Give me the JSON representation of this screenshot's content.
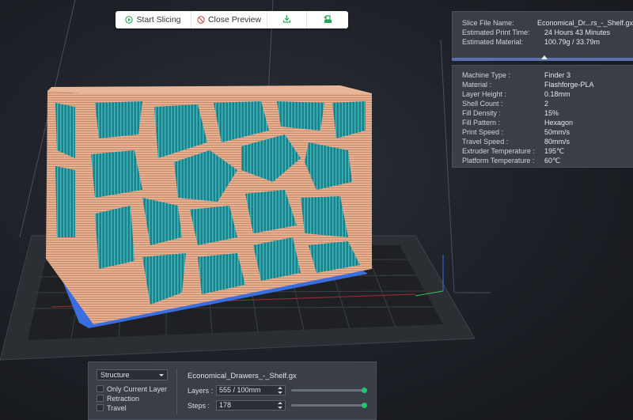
{
  "toolbar": {
    "start_label": "Start Slicing",
    "close_label": "Close Preview",
    "export_icon": "download-icon",
    "print_icon": "print-send-icon"
  },
  "info": {
    "rows": [
      {
        "k": "Slice File Name:",
        "v": "Economical_Dr...rs_-_Shelf.gx"
      },
      {
        "k": "Estimated Print Time:",
        "v": "24 Hours 43 Minutes"
      },
      {
        "k": "Estimated Material:",
        "v": "100.79g / 33.79m"
      }
    ]
  },
  "details": {
    "rows": [
      {
        "k": "Machine Type :",
        "v": "Finder 3"
      },
      {
        "k": "Material :",
        "v": "Flashforge-PLA"
      },
      {
        "k": "Layer Height :",
        "v": "0.18mm"
      },
      {
        "k": "Shell Count :",
        "v": "2"
      },
      {
        "k": "Fill Density :",
        "v": "15%"
      },
      {
        "k": "Fill Pattern :",
        "v": "Hexagon"
      },
      {
        "k": "Print Speed :",
        "v": "50mm/s"
      },
      {
        "k": "Travel Speed :",
        "v": "80mm/s"
      },
      {
        "k": "Extruder Temperature :",
        "v": "195℃"
      },
      {
        "k": "Platform Temperature :",
        "v": "60℃"
      }
    ]
  },
  "bottom": {
    "structure_value": "Structure",
    "checks": [
      "Only Current Layer",
      "Retraction",
      "Travel"
    ],
    "file_name": "Economical_Drawers_-_Shelf.gx",
    "layers_label": "Layers :",
    "layers_value": "555 / 100mm",
    "steps_label": "Steps :",
    "steps_value": "178",
    "layers_slider_fraction": 1.0,
    "steps_slider_fraction": 1.0
  },
  "colors": {
    "accent": "#5a6fb0",
    "slider_knob": "#1fc96a",
    "model": "#e0a98a",
    "infill": "#2a9aa0",
    "raft": "#3a6ee0"
  }
}
